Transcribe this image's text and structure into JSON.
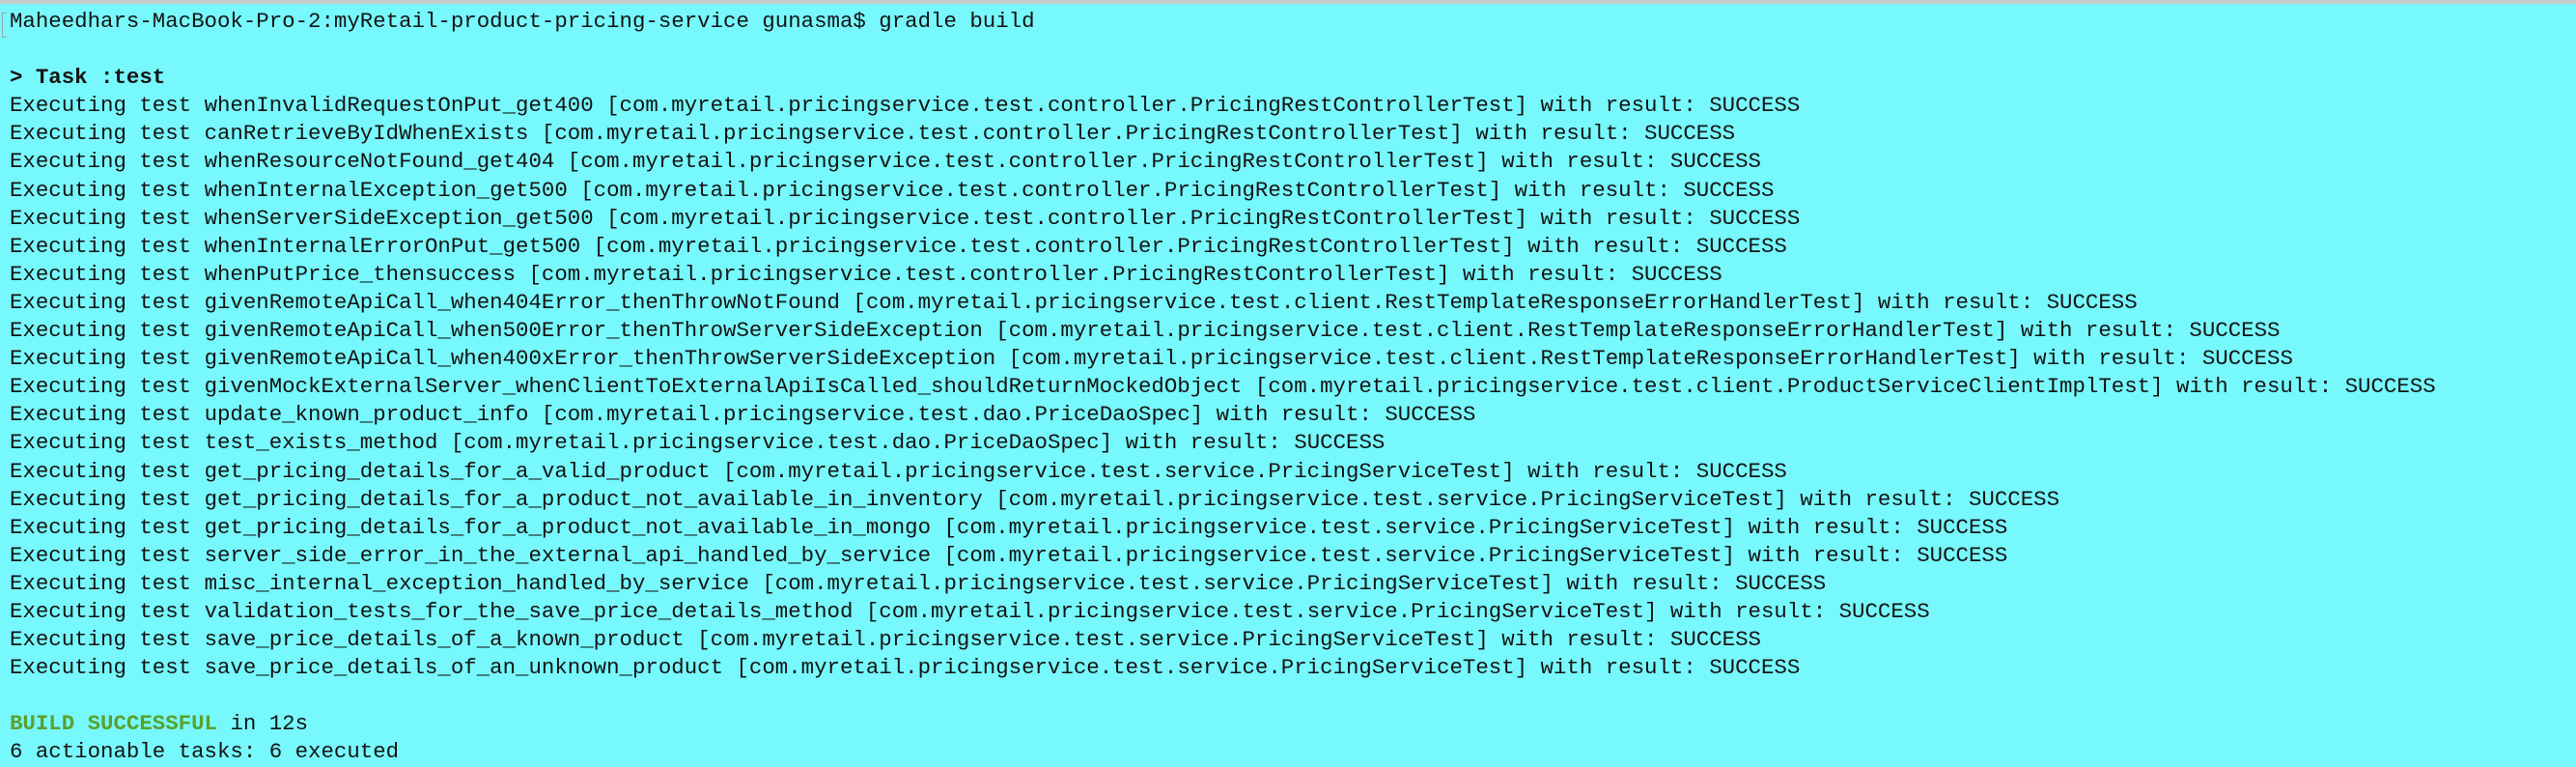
{
  "prompt": {
    "host_path_user": "Maheedhars-MacBook-Pro-2:myRetail-product-pricing-service gunasma$",
    "command": "gradle build"
  },
  "task_header": "> Task :test",
  "test_prefix": "Executing test",
  "result_prefix": "with result:",
  "tests": [
    {
      "name": "whenInvalidRequestOnPut_get400",
      "class": "com.myretail.pricingservice.test.controller.PricingRestControllerTest",
      "result": "SUCCESS"
    },
    {
      "name": "canRetrieveByIdWhenExists",
      "class": "com.myretail.pricingservice.test.controller.PricingRestControllerTest",
      "result": "SUCCESS"
    },
    {
      "name": "whenResourceNotFound_get404",
      "class": "com.myretail.pricingservice.test.controller.PricingRestControllerTest",
      "result": "SUCCESS"
    },
    {
      "name": "whenInternalException_get500",
      "class": "com.myretail.pricingservice.test.controller.PricingRestControllerTest",
      "result": "SUCCESS"
    },
    {
      "name": "whenServerSideException_get500",
      "class": "com.myretail.pricingservice.test.controller.PricingRestControllerTest",
      "result": "SUCCESS"
    },
    {
      "name": "whenInternalErrorOnPut_get500",
      "class": "com.myretail.pricingservice.test.controller.PricingRestControllerTest",
      "result": "SUCCESS"
    },
    {
      "name": "whenPutPrice_thensuccess",
      "class": "com.myretail.pricingservice.test.controller.PricingRestControllerTest",
      "result": "SUCCESS"
    },
    {
      "name": "givenRemoteApiCall_when404Error_thenThrowNotFound",
      "class": "com.myretail.pricingservice.test.client.RestTemplateResponseErrorHandlerTest",
      "result": "SUCCESS"
    },
    {
      "name": "givenRemoteApiCall_when500Error_thenThrowServerSideException",
      "class": "com.myretail.pricingservice.test.client.RestTemplateResponseErrorHandlerTest",
      "result": "SUCCESS"
    },
    {
      "name": "givenRemoteApiCall_when400xError_thenThrowServerSideException",
      "class": "com.myretail.pricingservice.test.client.RestTemplateResponseErrorHandlerTest",
      "result": "SUCCESS"
    },
    {
      "name": "givenMockExternalServer_whenClientToExternalApiIsCalled_shouldReturnMockedObject",
      "class": "com.myretail.pricingservice.test.client.ProductServiceClientImplTest",
      "result": "SUCCESS"
    },
    {
      "name": "update_known_product_info",
      "class": "com.myretail.pricingservice.test.dao.PriceDaoSpec",
      "result": "SUCCESS"
    },
    {
      "name": "test_exists_method",
      "class": "com.myretail.pricingservice.test.dao.PriceDaoSpec",
      "result": "SUCCESS"
    },
    {
      "name": "get_pricing_details_for_a_valid_product",
      "class": "com.myretail.pricingservice.test.service.PricingServiceTest",
      "result": "SUCCESS"
    },
    {
      "name": "get_pricing_details_for_a_product_not_available_in_inventory",
      "class": "com.myretail.pricingservice.test.service.PricingServiceTest",
      "result": "SUCCESS"
    },
    {
      "name": "get_pricing_details_for_a_product_not_available_in_mongo",
      "class": "com.myretail.pricingservice.test.service.PricingServiceTest",
      "result": "SUCCESS"
    },
    {
      "name": "server_side_error_in_the_external_api_handled_by_service",
      "class": "com.myretail.pricingservice.test.service.PricingServiceTest",
      "result": "SUCCESS"
    },
    {
      "name": "misc_internal_exception_handled_by_service",
      "class": "com.myretail.pricingservice.test.service.PricingServiceTest",
      "result": "SUCCESS"
    },
    {
      "name": "validation_tests_for_the_save_price_details_method",
      "class": "com.myretail.pricingservice.test.service.PricingServiceTest",
      "result": "SUCCESS"
    },
    {
      "name": "save_price_details_of_a_known_product",
      "class": "com.myretail.pricingservice.test.service.PricingServiceTest",
      "result": "SUCCESS"
    },
    {
      "name": "save_price_details_of_an_unknown_product",
      "class": "com.myretail.pricingservice.test.service.PricingServiceTest",
      "result": "SUCCESS"
    }
  ],
  "build": {
    "status": "BUILD SUCCESSFUL",
    "duration": "in 12s",
    "summary": "6 actionable tasks: 6 executed"
  },
  "colors": {
    "background": "#76f8fc",
    "success": "#5aa12e",
    "text": "#141414"
  }
}
